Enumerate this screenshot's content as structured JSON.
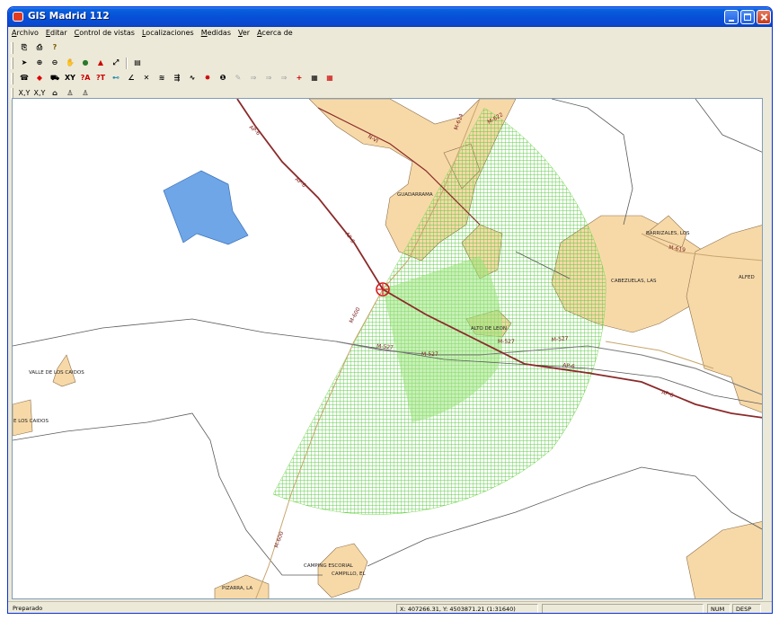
{
  "window": {
    "title": "GIS Madrid 112"
  },
  "menu": [
    "Archivo",
    "Editar",
    "Control de vistas",
    "Localizaciones",
    "Medidas",
    "Ver",
    "Acerca de"
  ],
  "toolbar": {
    "row3_text": [
      "XY",
      "?A",
      "?T"
    ],
    "row4_text": [
      "X,Y",
      "X,Y"
    ]
  },
  "map": {
    "colors": {
      "urban": "#f7d9a8",
      "coverage": "#7ed957",
      "lake": "#6ea6e8",
      "highway": "#8b2a2a",
      "road": "#c8a56e",
      "border": "#5a5a5a"
    },
    "places": [
      "GUADARRAMA",
      "BARRIZALES, LOS",
      "CABEZUELAS, LAS",
      "ALFED",
      "VALLE DE LOS CAIDOS",
      "E LOS CAIDOS",
      "CAMPING ESCORIAL",
      "CAMPILLO, EL",
      "PIZARRA, LA",
      "ALTO DE LEON"
    ],
    "roads": [
      "AP-6",
      "AP-6",
      "AP-6",
      "AP-6",
      "AP-6",
      "N-VI",
      "M-614",
      "M-622",
      "M-619",
      "M-600",
      "M-600",
      "M-527",
      "M-527",
      "M-527",
      "M-527"
    ]
  },
  "status": {
    "text": "Preparado",
    "coords": "X: 407266.31, Y: 4503871.21 (1:31640)",
    "num": "NUM",
    "desp": "DESP"
  }
}
